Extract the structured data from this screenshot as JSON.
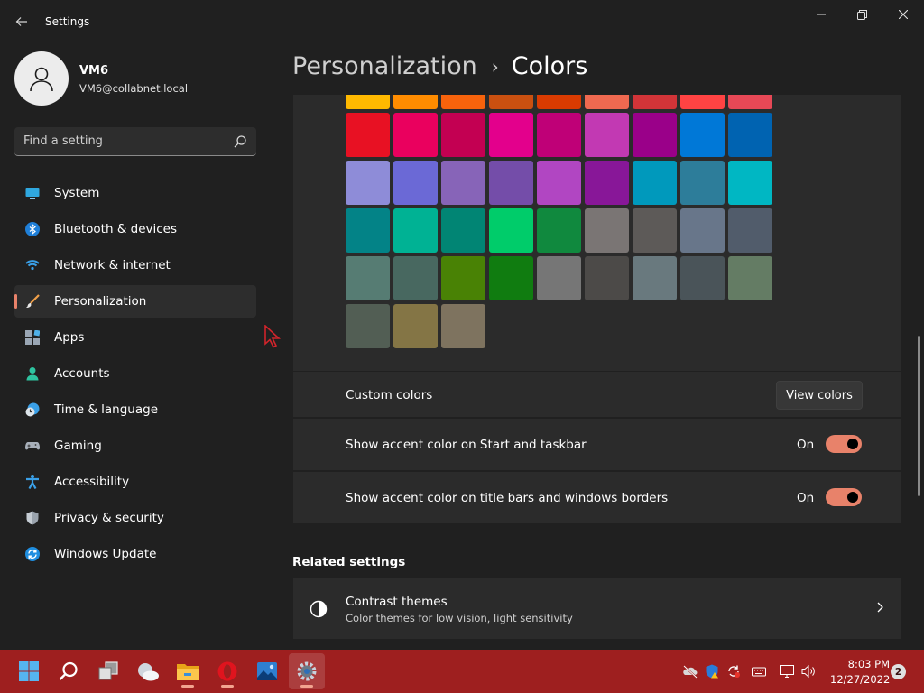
{
  "window": {
    "title": "Settings"
  },
  "user": {
    "name": "VM6",
    "email": "VM6@collabnet.local"
  },
  "search": {
    "placeholder": "Find a setting"
  },
  "nav": {
    "items": [
      {
        "label": "System",
        "icon": "monitor-icon",
        "selected": false
      },
      {
        "label": "Bluetooth & devices",
        "icon": "bluetooth-icon",
        "selected": false
      },
      {
        "label": "Network & internet",
        "icon": "wifi-icon",
        "selected": false
      },
      {
        "label": "Personalization",
        "icon": "brush-icon",
        "selected": true
      },
      {
        "label": "Apps",
        "icon": "apps-icon",
        "selected": false
      },
      {
        "label": "Accounts",
        "icon": "person-icon",
        "selected": false
      },
      {
        "label": "Time & language",
        "icon": "globe-clock-icon",
        "selected": false
      },
      {
        "label": "Gaming",
        "icon": "gamepad-icon",
        "selected": false
      },
      {
        "label": "Accessibility",
        "icon": "accessibility-icon",
        "selected": false
      },
      {
        "label": "Privacy & security",
        "icon": "shield-icon",
        "selected": false
      },
      {
        "label": "Windows Update",
        "icon": "sync-icon",
        "selected": false
      }
    ]
  },
  "header": {
    "parent": "Personalization",
    "separator": "›",
    "current": "Colors"
  },
  "accent_colors": [
    "#ffb900",
    "#ff8c00",
    "#f7630c",
    "#ca5010",
    "#da3b01",
    "#ef6950",
    "#d13438",
    "#ff4343",
    "#e74856",
    "#e81123",
    "#ea005e",
    "#c30052",
    "#e3008c",
    "#bf0077",
    "#c239b3",
    "#9a0089",
    "#0078d7",
    "#0063b1",
    "#8e8cd8",
    "#6b69d6",
    "#8764b8",
    "#744da9",
    "#b146c2",
    "#881798",
    "#0099bc",
    "#2d7d9a",
    "#00b7c3",
    "#038387",
    "#00b294",
    "#018574",
    "#00cc6a",
    "#10893e",
    "#7a7574",
    "#5d5a58",
    "#68768a",
    "#515c6b",
    "#567c73",
    "#486860",
    "#498205",
    "#107c10",
    "#767676",
    "#4c4a48",
    "#69797e",
    "#4a5459",
    "#647c64",
    "#525e54",
    "#847545",
    "#7e735f"
  ],
  "custom_colors": {
    "label": "Custom colors",
    "button": "View colors"
  },
  "toggles": [
    {
      "label": "Show accent color on Start and taskbar",
      "state": "On",
      "on": true
    },
    {
      "label": "Show accent color on title bars and windows borders",
      "state": "On",
      "on": true
    }
  ],
  "related": {
    "heading": "Related settings",
    "contrast": {
      "title": "Contrast themes",
      "subtitle": "Color themes for low vision, light sensitivity"
    }
  },
  "taskbar": {
    "apps": [
      "start-icon",
      "search-icon",
      "task-view-icon",
      "weather-icon",
      "file-explorer-icon",
      "opera-icon",
      "photos-icon",
      "settings-icon"
    ],
    "clock": {
      "time": "8:03 PM",
      "date": "12/27/2022"
    },
    "notifications": "2",
    "accent": "#9e1f1f"
  },
  "accent": "#e8826a"
}
